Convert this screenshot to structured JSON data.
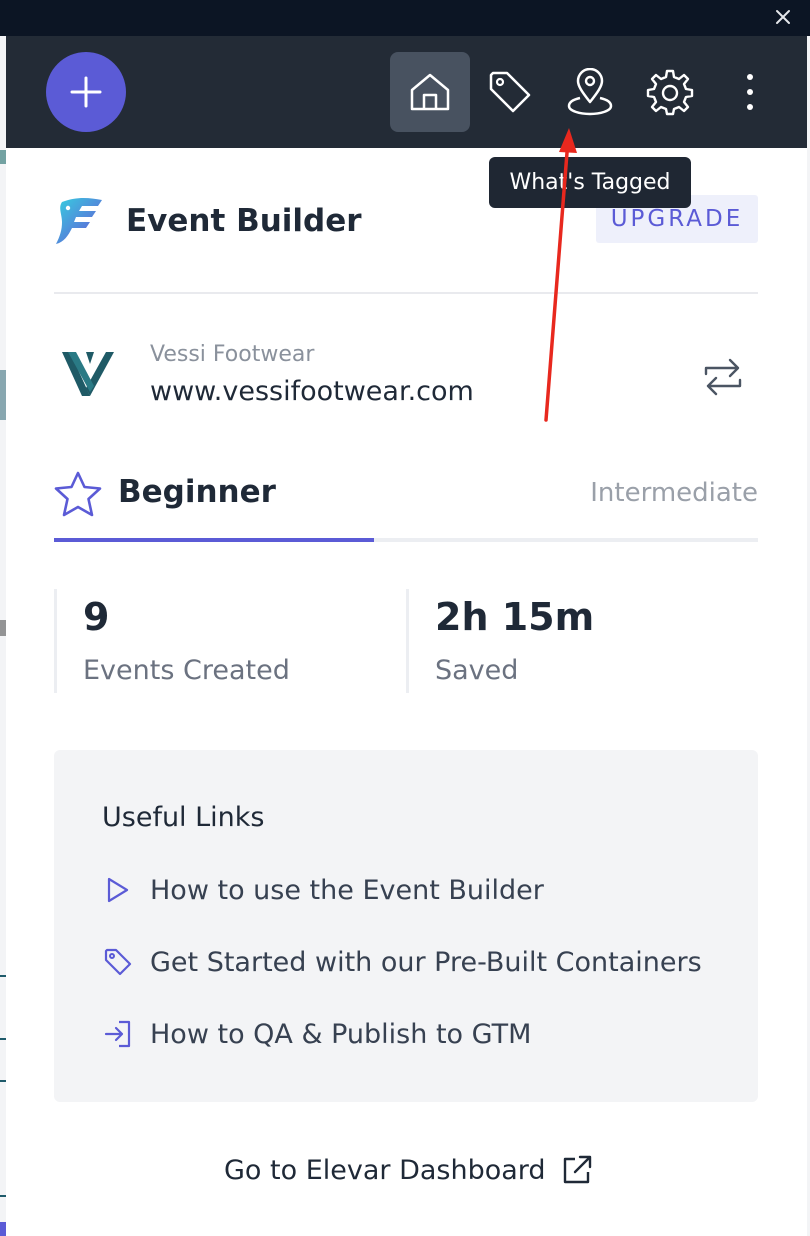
{
  "navbar": {
    "add_label": "+",
    "active_tab": "home"
  },
  "tooltip": {
    "text": "What's Tagged"
  },
  "header": {
    "title": "Event Builder",
    "upgrade_label": "UPGRADE"
  },
  "store": {
    "name": "Vessi Footwear",
    "url": "www.vessifootwear.com"
  },
  "level": {
    "current": "Beginner",
    "next": "Intermediate",
    "progress_fraction": 0.455
  },
  "stats": [
    {
      "value": "9",
      "label": "Events Created"
    },
    {
      "value": "2h 15m",
      "label": "Saved"
    }
  ],
  "useful_links": {
    "title": "Useful Links",
    "items": [
      {
        "label": "How to use the Event Builder",
        "icon": "play-icon"
      },
      {
        "label": "Get Started with our Pre-Built Containers",
        "icon": "tag-icon"
      },
      {
        "label": "How to QA & Publish to GTM",
        "icon": "sign-in-icon"
      }
    ]
  },
  "footer": {
    "dashboard_label": "Go to Elevar Dashboard"
  },
  "colors": {
    "accent": "#5b5bd6",
    "navbar": "#232b36",
    "titlebar": "#0c1524",
    "annotation_arrow": "#e8281e"
  }
}
